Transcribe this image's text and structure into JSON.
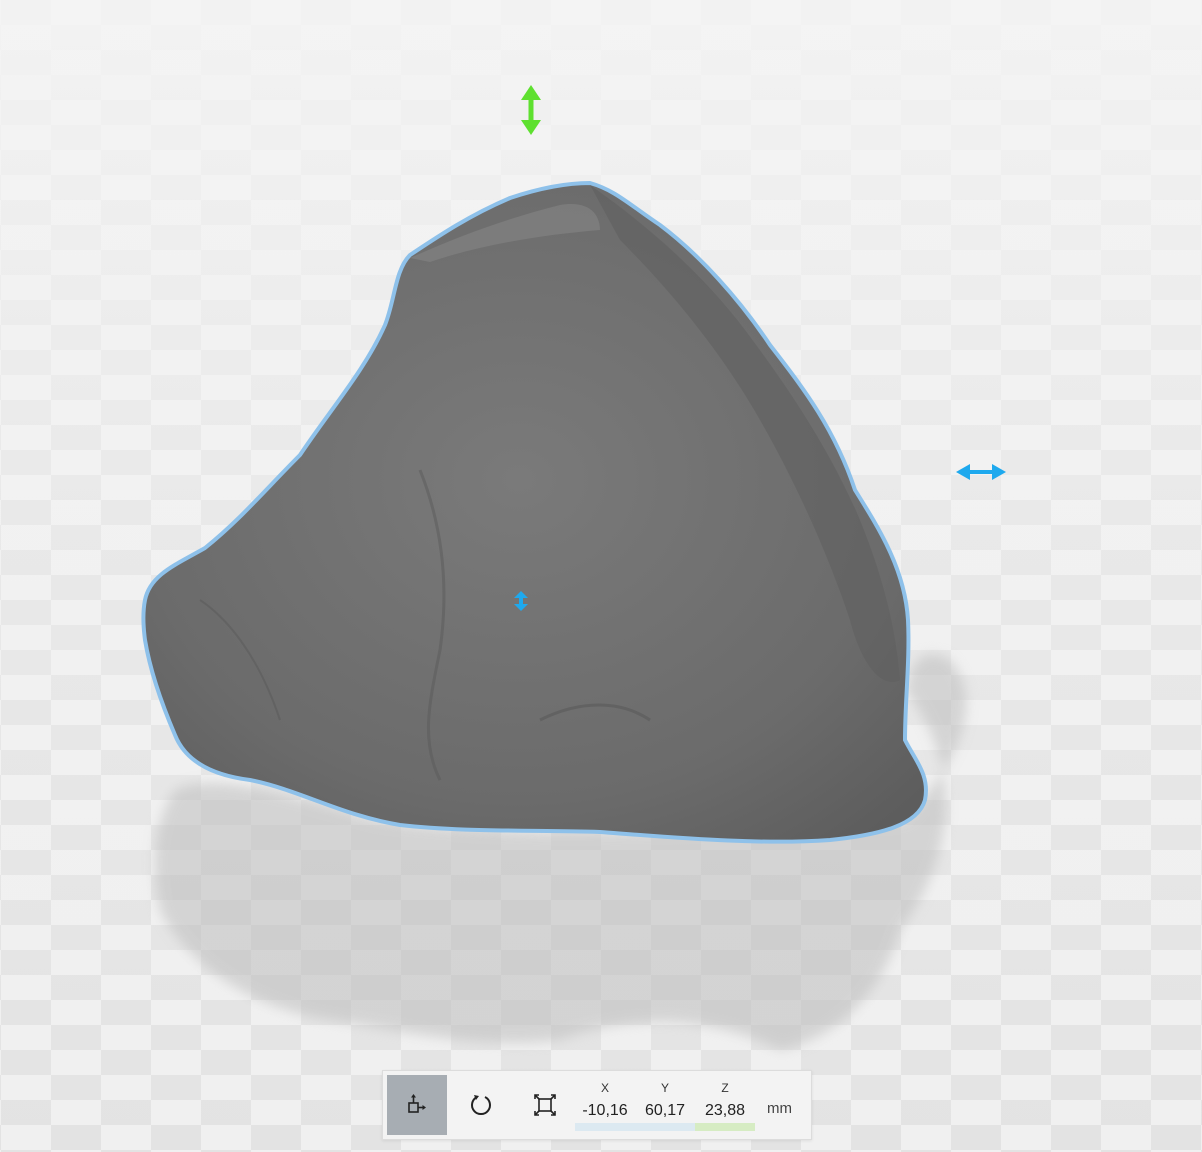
{
  "viewport": {
    "background_color": "#ececec",
    "checker_light": "#f2f2f2",
    "checker_dark": "#e2e2e2",
    "model_color": "#6f6f6f",
    "selection_outline_color": "#8ec1ea"
  },
  "gizmo": {
    "vertical_arrow_color": "#5ee02f",
    "horizontal_arrow_color": "#1ea9ee",
    "center_handle_color": "#1ea9ee"
  },
  "toolbar": {
    "tools": [
      {
        "name": "move",
        "icon": "move-icon",
        "active": true
      },
      {
        "name": "rotate",
        "icon": "rotate-icon",
        "active": false
      },
      {
        "name": "scale",
        "icon": "scale-icon",
        "active": false
      }
    ],
    "coordinates": {
      "x_label": "X",
      "x_value": "-10,16",
      "y_label": "Y",
      "y_value": "60,17",
      "z_label": "Z",
      "z_value": "23,88"
    },
    "unit": "mm",
    "colors": {
      "x_bar": "#dce9f1",
      "y_bar": "#dce9f1",
      "z_bar": "#d6ecc3",
      "active_tool_bg": "#a7adb3"
    }
  }
}
